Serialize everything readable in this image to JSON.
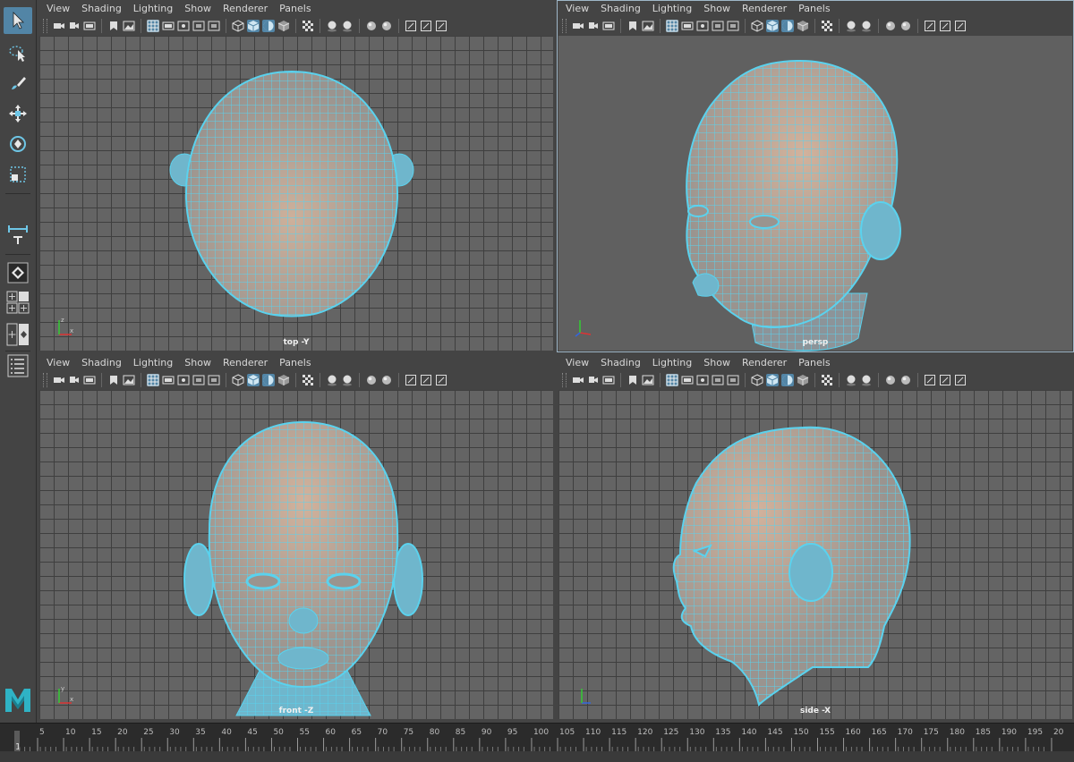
{
  "menu": [
    "View",
    "Shading",
    "Lighting",
    "Show",
    "Renderer",
    "Panels"
  ],
  "viewports": [
    {
      "id": "top",
      "label": "top -Y",
      "active": false
    },
    {
      "id": "persp",
      "label": "persp",
      "active": true
    },
    {
      "id": "front",
      "label": "front -Z",
      "active": false
    },
    {
      "id": "side",
      "label": "side -X",
      "active": false
    }
  ],
  "toolbox": {
    "tools": [
      "select-arrow-icon",
      "lasso-select-icon",
      "paint-select-icon",
      "move-tool-icon",
      "rotate-tool-icon",
      "scale-tool-icon",
      "distance-tool-icon",
      "single-perspective-layout-icon",
      "four-view-layout-icon",
      "outliner-layout-icon"
    ],
    "logo": "maya-logo"
  },
  "timeline": {
    "current_frame": "1",
    "tick_labels": [
      "5",
      "10",
      "15",
      "20",
      "25",
      "30",
      "35",
      "40",
      "45",
      "50",
      "55",
      "60",
      "65",
      "70",
      "75",
      "80",
      "85",
      "90",
      "95",
      "100",
      "105",
      "110",
      "115",
      "120",
      "125",
      "130",
      "135",
      "140",
      "145",
      "150",
      "155",
      "160",
      "165",
      "170",
      "175",
      "180",
      "185",
      "190",
      "195",
      "20"
    ]
  },
  "colors": {
    "accent": "#5285a6",
    "wireframe": "#5ad2ee",
    "skin": "#c4a691",
    "viewport_bg": "#606060"
  }
}
